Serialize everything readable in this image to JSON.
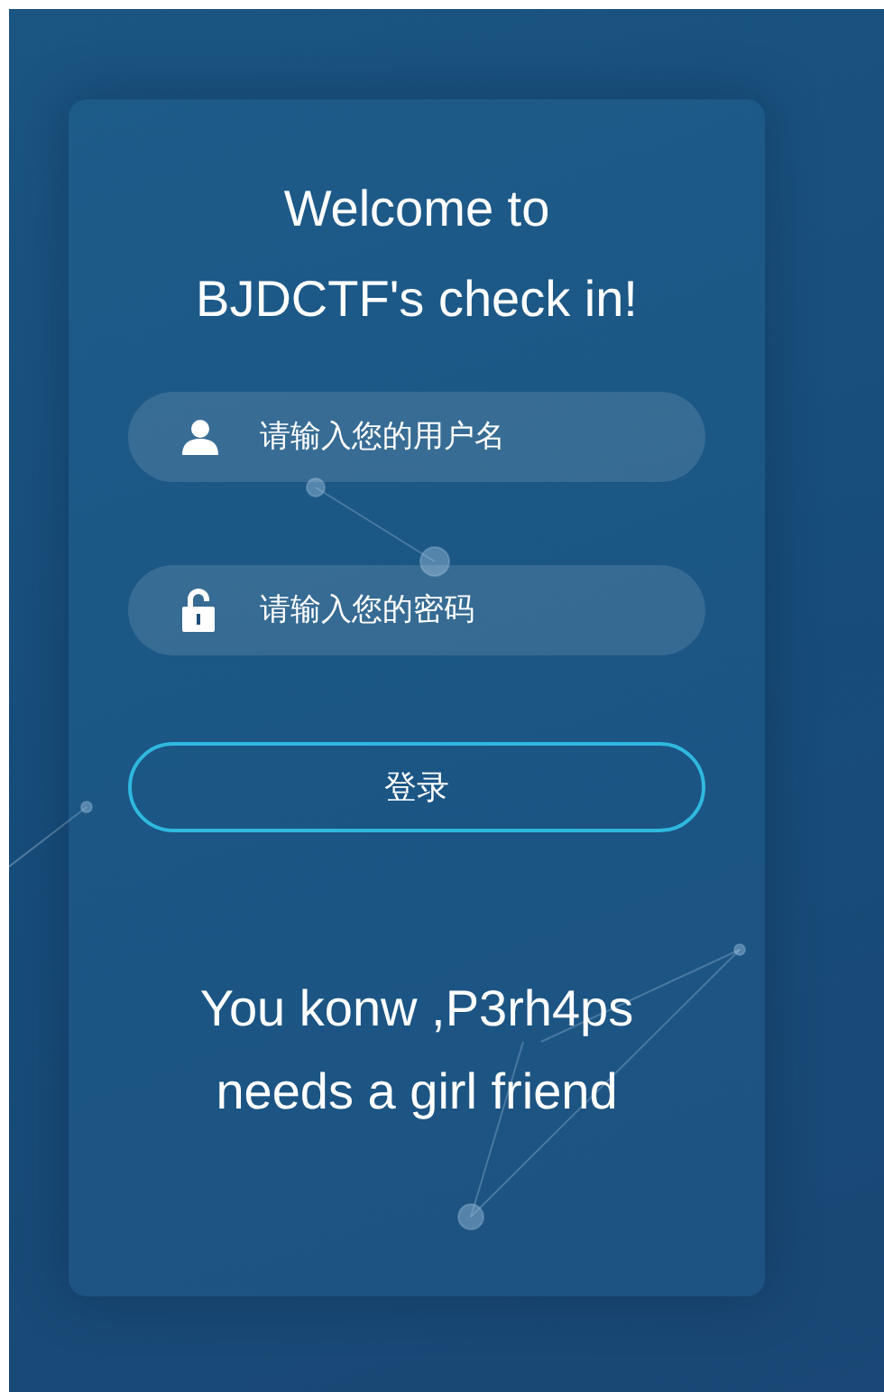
{
  "title_lines": [
    "Welcome to",
    "BJDCTF's check in!"
  ],
  "fields": [
    {
      "kind": "user",
      "placeholder": "请输入您的用户名"
    },
    {
      "kind": "password",
      "placeholder": "请输入您的密码"
    }
  ],
  "login_button": "登录",
  "message_lines": [
    "You konw ,P3rh4ps",
    "needs a girl friend"
  ]
}
